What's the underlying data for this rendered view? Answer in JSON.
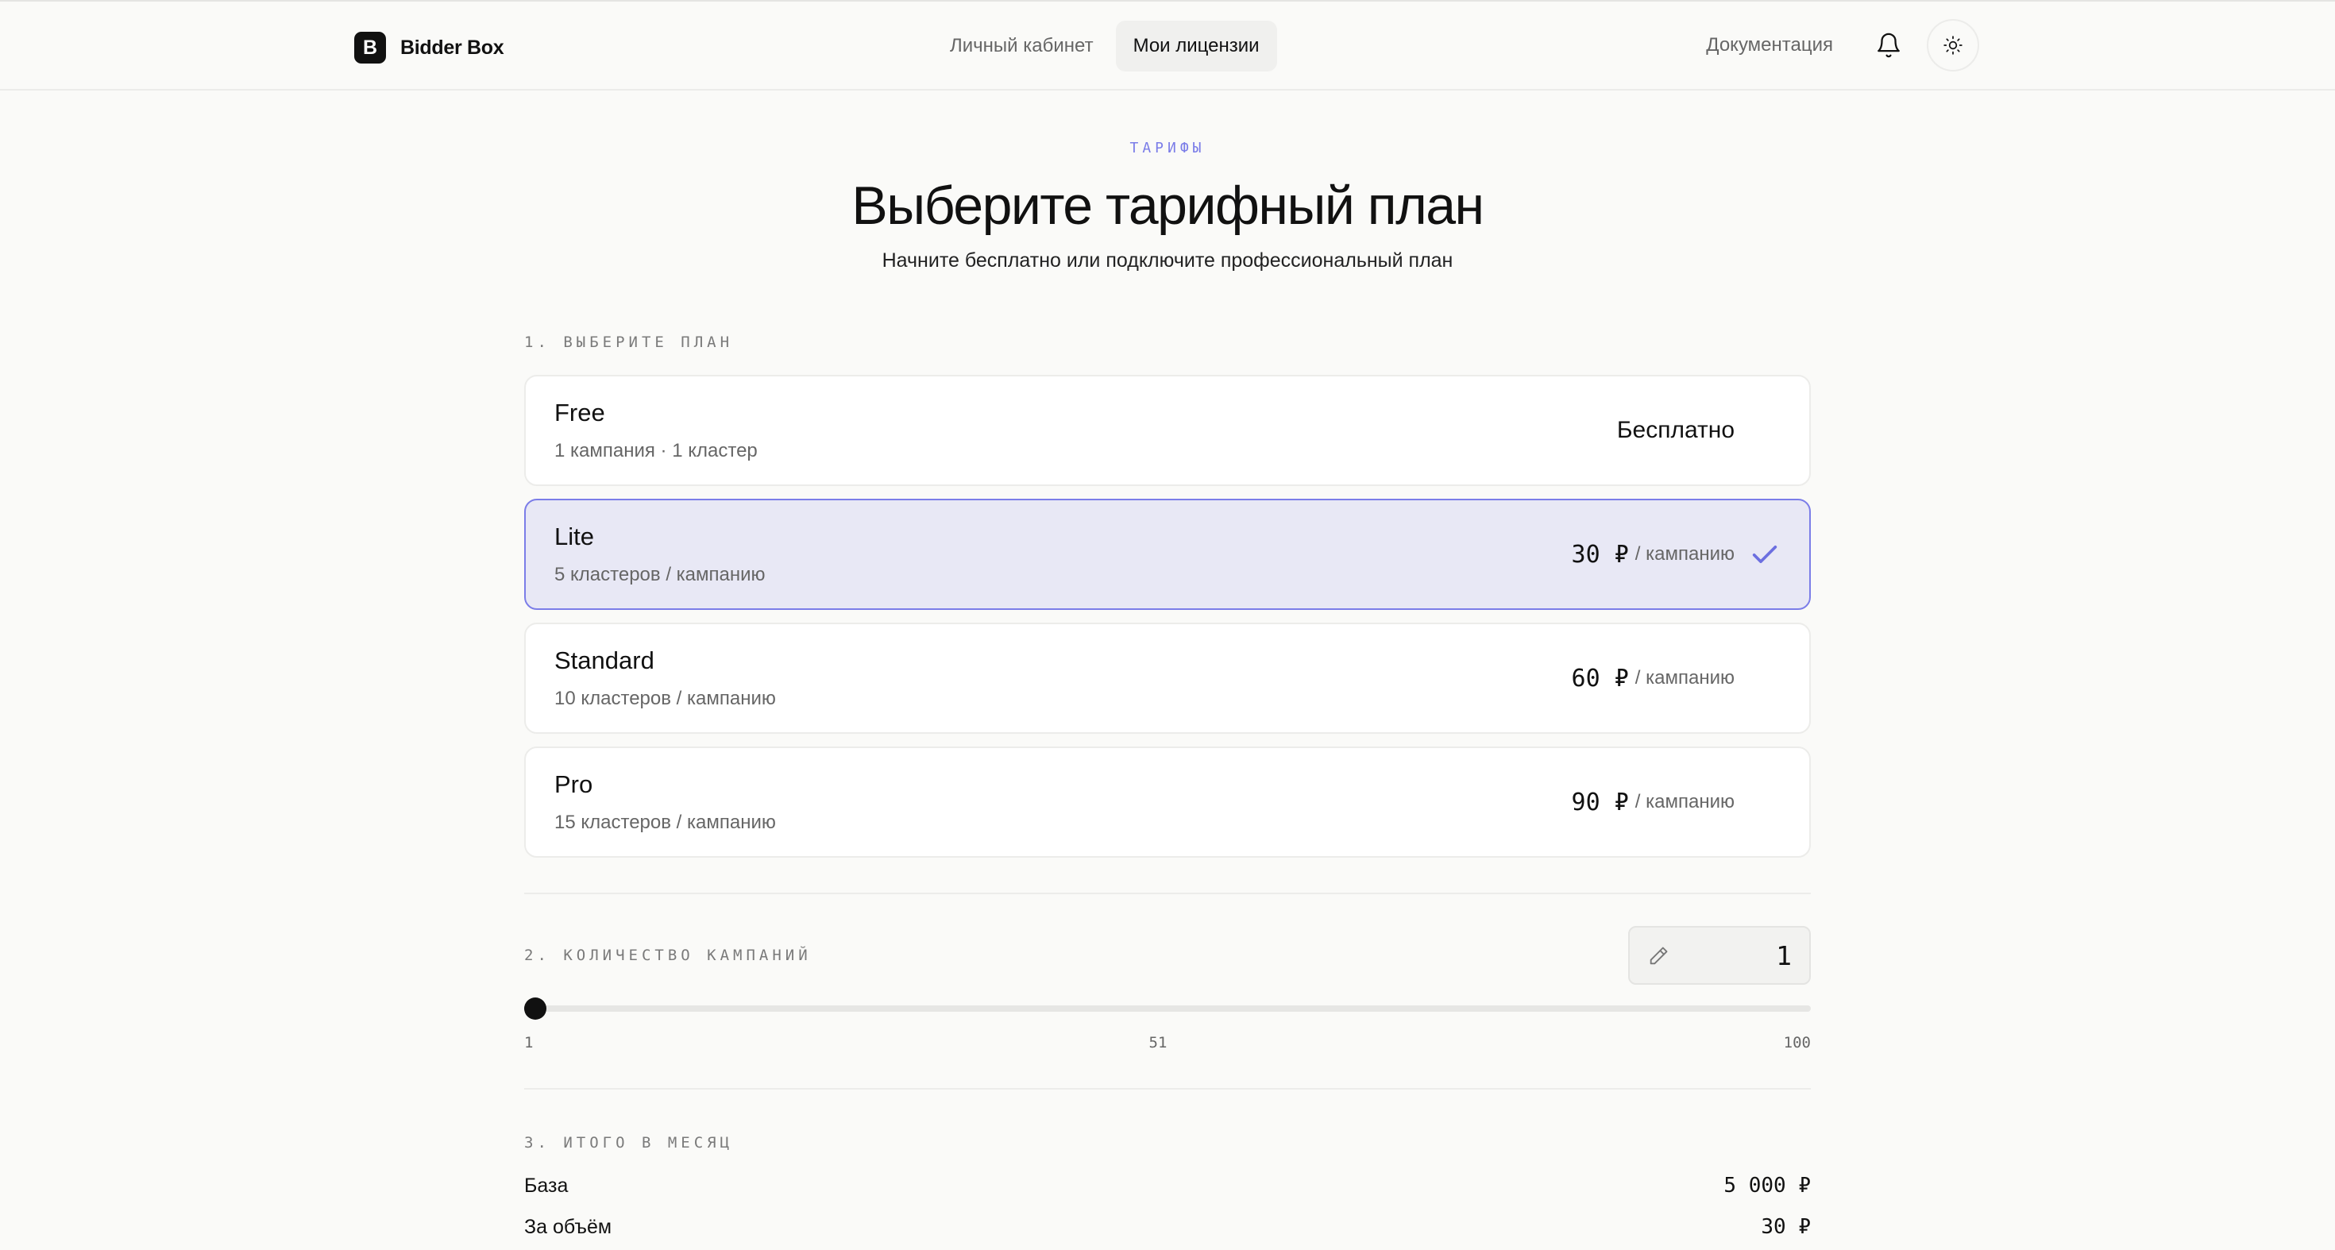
{
  "header": {
    "brand_initial": "B",
    "brand_name": "Bidder Box",
    "nav": [
      {
        "label": "Личный кабинет",
        "active": false
      },
      {
        "label": "Мои лицензии",
        "active": true
      }
    ],
    "docs_label": "Документация",
    "icons": {
      "notifications": "bell-icon",
      "theme": "sun-icon"
    }
  },
  "hero": {
    "eyebrow": "ТАРИФЫ",
    "title": "Выберите тарифный план",
    "subtitle": "Начните бесплатно или подключите профессиональный план"
  },
  "step1": {
    "label": "1. ВЫБЕРИТЕ ПЛАН",
    "plans": [
      {
        "name": "Free",
        "desc": "1 кампания · 1 кластер",
        "price_text": "Бесплатно",
        "price": "",
        "unit": "",
        "selected": false
      },
      {
        "name": "Lite",
        "desc": "5 кластеров / кампанию",
        "price_text": "",
        "price": "30 ₽",
        "unit": "/ кампанию",
        "selected": true
      },
      {
        "name": "Standard",
        "desc": "10 кластеров / кампанию",
        "price_text": "",
        "price": "60 ₽",
        "unit": "/ кампанию",
        "selected": false
      },
      {
        "name": "Pro",
        "desc": "15 кластеров / кампанию",
        "price_text": "",
        "price": "90 ₽",
        "unit": "/ кампанию",
        "selected": false
      }
    ]
  },
  "step2": {
    "label": "2. КОЛИЧЕСТВО КАМПАНИЙ",
    "value": "1",
    "slider": {
      "min": 1,
      "max": 100,
      "value": 1,
      "ticks": [
        "1",
        "51",
        "100"
      ]
    }
  },
  "step3": {
    "label": "3. ИТОГО В МЕСЯЦ",
    "rows": [
      {
        "label": "База",
        "value": "5 000 ₽"
      },
      {
        "label": "За объём",
        "value": "30 ₽"
      }
    ]
  },
  "colors": {
    "accent": "#7b7de8",
    "selected_bg": "#e8e8f5",
    "background": "#fafaf8"
  }
}
